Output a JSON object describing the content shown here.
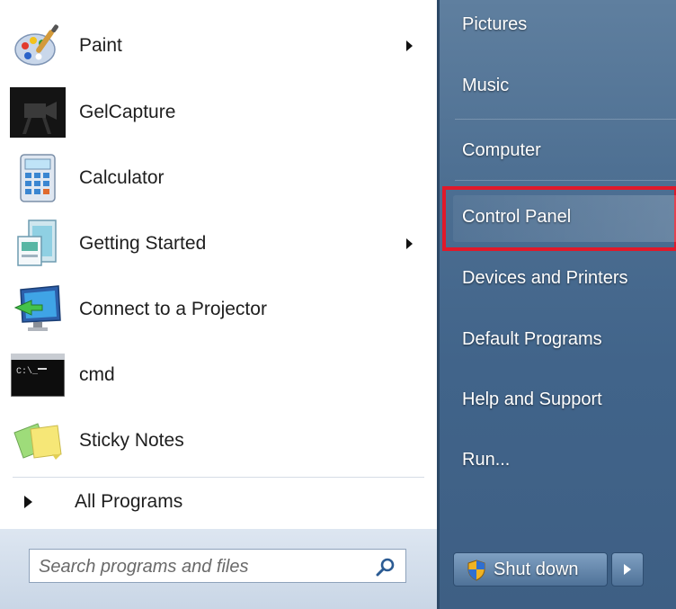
{
  "programs": [
    {
      "label": "Paint",
      "icon": "paint-icon",
      "has_submenu": true
    },
    {
      "label": "GelCapture",
      "icon": "camera-icon",
      "has_submenu": false
    },
    {
      "label": "Calculator",
      "icon": "calculator-icon",
      "has_submenu": false
    },
    {
      "label": "Getting Started",
      "icon": "getting-started-icon",
      "has_submenu": true
    },
    {
      "label": "Connect to a Projector",
      "icon": "projector-icon",
      "has_submenu": false
    },
    {
      "label": "cmd",
      "icon": "cmd-icon",
      "has_submenu": false
    },
    {
      "label": "Sticky Notes",
      "icon": "sticky-notes-icon",
      "has_submenu": false
    }
  ],
  "all_programs": {
    "label": "All Programs"
  },
  "search": {
    "placeholder": "Search programs and files",
    "value": ""
  },
  "right_menu": [
    {
      "label": "Pictures"
    },
    {
      "label": "Music"
    },
    {
      "label": "Computer"
    },
    {
      "label": "Control Panel",
      "highlighted": true
    },
    {
      "label": "Devices and Printers"
    },
    {
      "label": "Default Programs"
    },
    {
      "label": "Help and Support"
    },
    {
      "label": "Run..."
    }
  ],
  "shutdown": {
    "label": "Shut down"
  },
  "colors": {
    "highlight_border": "#e0192a",
    "right_pane": "#4d6f92"
  }
}
